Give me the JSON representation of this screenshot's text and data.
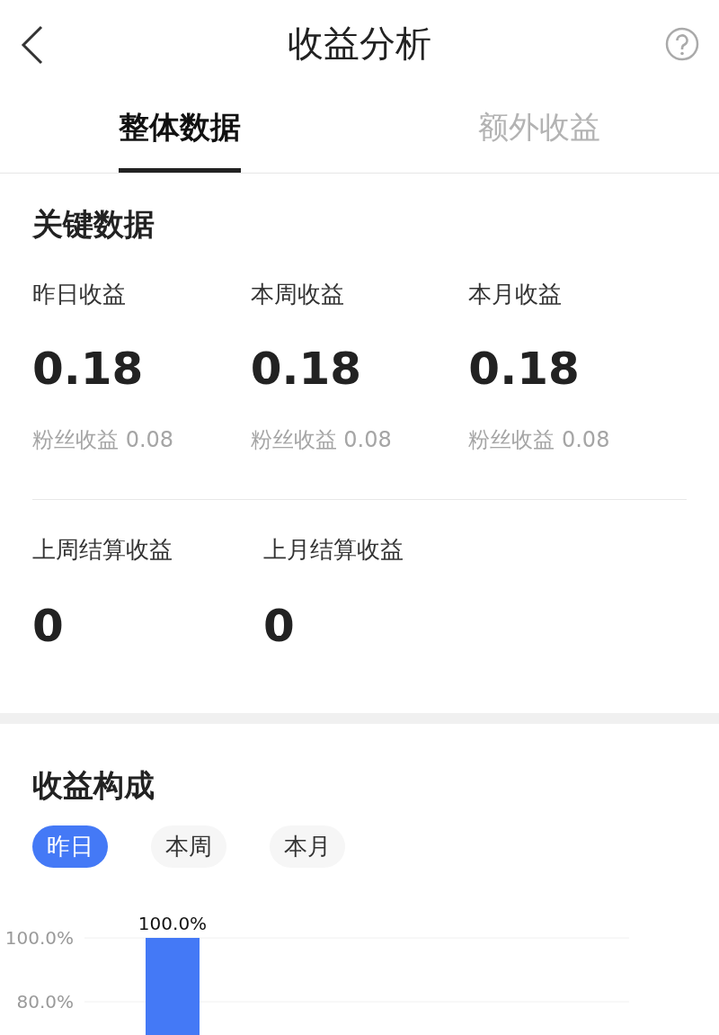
{
  "header": {
    "title": "收益分析"
  },
  "tabs": [
    {
      "label": "整体数据",
      "selected": true
    },
    {
      "label": "额外收益",
      "selected": false
    }
  ],
  "key_data": {
    "title": "关键数据",
    "stats": [
      {
        "label": "昨日收益",
        "value": "0.18",
        "sub": "粉丝收益 0.08"
      },
      {
        "label": "本周收益",
        "value": "0.18",
        "sub": "粉丝收益 0.08"
      },
      {
        "label": "本月收益",
        "value": "0.18",
        "sub": "粉丝收益 0.08"
      }
    ],
    "settled": [
      {
        "label": "上周结算收益",
        "value": "0"
      },
      {
        "label": "上月结算收益",
        "value": "0"
      }
    ]
  },
  "composition": {
    "title": "收益构成",
    "periods": [
      {
        "label": "昨日",
        "selected": true
      },
      {
        "label": "本周",
        "selected": false
      },
      {
        "label": "本月",
        "selected": false
      }
    ],
    "chart_data": {
      "type": "bar",
      "series": [
        {
          "color": "#4479f6",
          "values": [
            100
          ]
        }
      ],
      "ylim": [
        0,
        100
      ],
      "yticks": [
        {
          "value": 80,
          "label": "80.0%"
        },
        {
          "value": 100,
          "label": "100.0%"
        }
      ],
      "value_labels": [
        "100.0%"
      ]
    }
  }
}
